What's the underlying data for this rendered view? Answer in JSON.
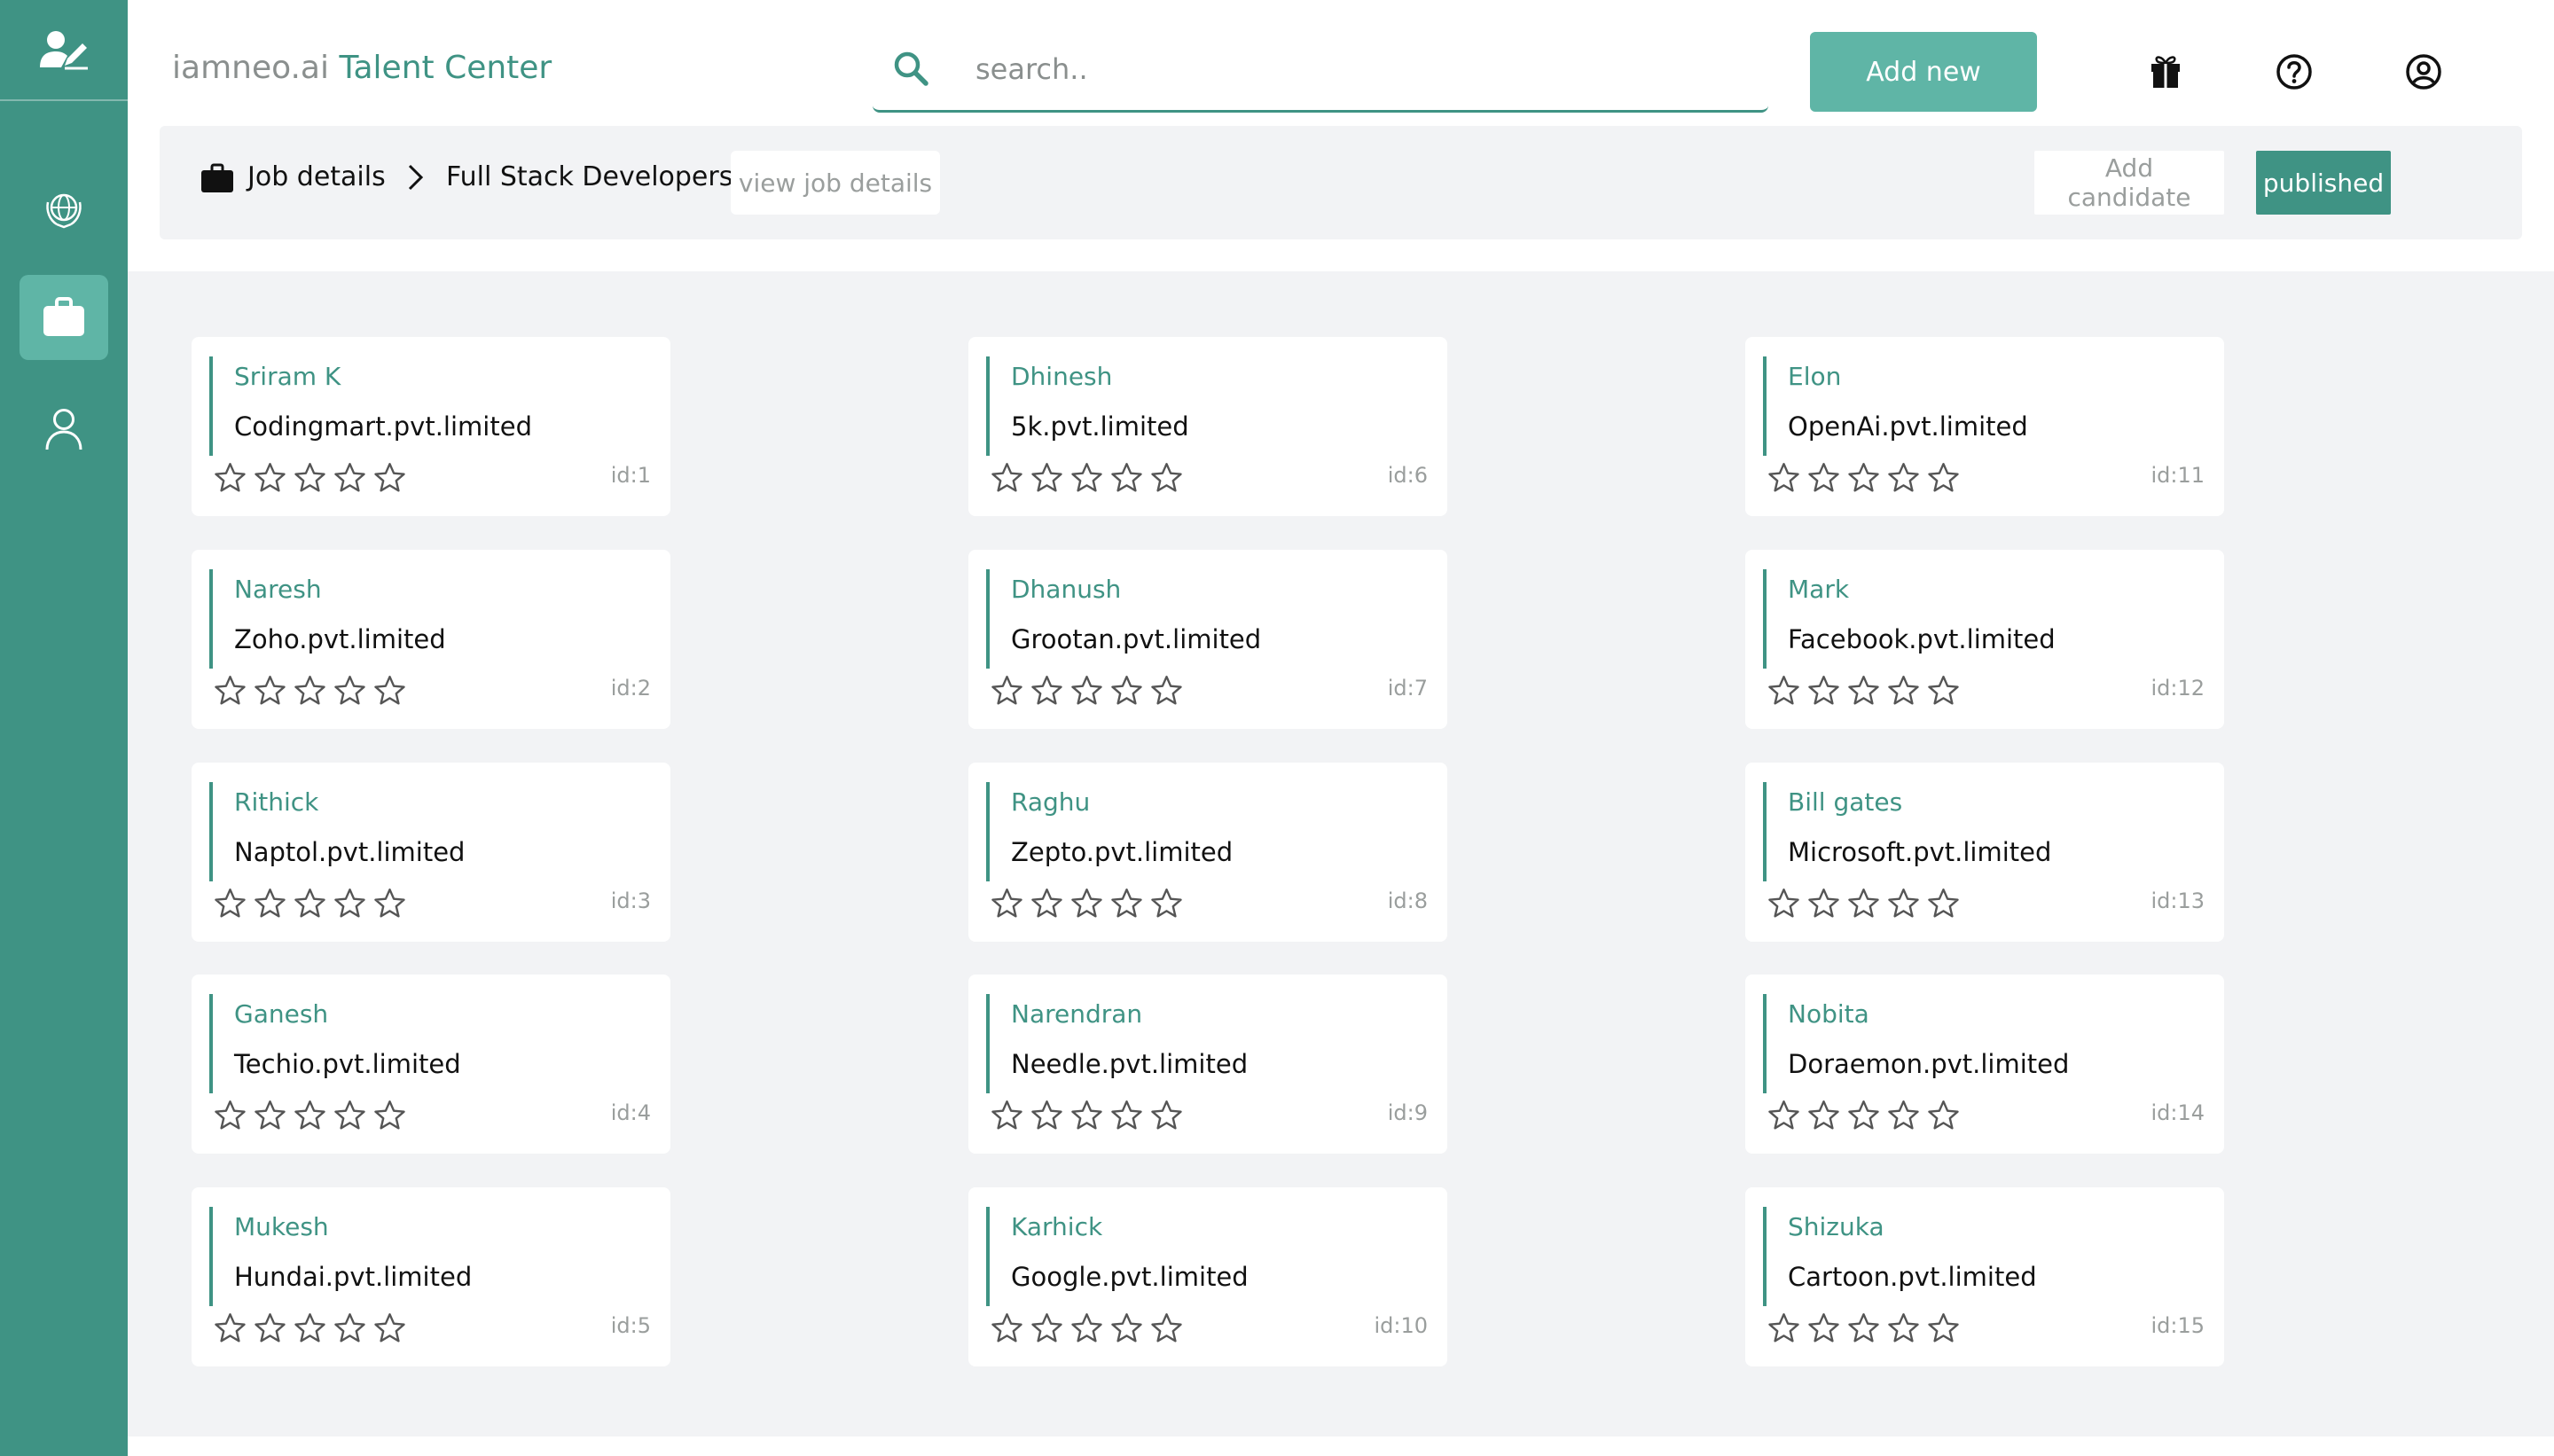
{
  "app": {
    "brand_prefix": "iamneo.ai",
    "brand_name": "Talent Center"
  },
  "sidebar": {
    "items": [
      {
        "name": "globe-icon",
        "active": false
      },
      {
        "name": "briefcase-icon",
        "active": true
      },
      {
        "name": "user-icon",
        "active": false
      }
    ]
  },
  "search": {
    "placeholder": "search..",
    "value": ""
  },
  "header": {
    "add_new_label": "Add new",
    "icons": [
      "gift-icon",
      "help-icon",
      "account-icon"
    ]
  },
  "job": {
    "section_label": "Job details",
    "title": "Full Stack Developers",
    "view_details_label": "view job details",
    "add_candidate_label": "Add candidate",
    "status_label": "published"
  },
  "colors": {
    "accent": "#3f9384",
    "accent_light": "#5fb5a6",
    "background": "#f2f3f5"
  },
  "candidates": [
    {
      "name": "Sriram K",
      "company": "Codingmart.pvt.limited",
      "id": "id:1",
      "rating": 0
    },
    {
      "name": "Naresh",
      "company": "Zoho.pvt.limited",
      "id": "id:2",
      "rating": 0
    },
    {
      "name": "Rithick",
      "company": "Naptol.pvt.limited",
      "id": "id:3",
      "rating": 0
    },
    {
      "name": "Ganesh",
      "company": "Techio.pvt.limited",
      "id": "id:4",
      "rating": 0
    },
    {
      "name": "Mukesh",
      "company": "Hundai.pvt.limited",
      "id": "id:5",
      "rating": 0
    },
    {
      "name": "Dhinesh",
      "company": "5k.pvt.limited",
      "id": "id:6",
      "rating": 0
    },
    {
      "name": "Dhanush",
      "company": "Grootan.pvt.limited",
      "id": "id:7",
      "rating": 0
    },
    {
      "name": "Raghu",
      "company": "Zepto.pvt.limited",
      "id": "id:8",
      "rating": 0
    },
    {
      "name": "Narendran",
      "company": "Needle.pvt.limited",
      "id": "id:9",
      "rating": 0
    },
    {
      "name": "Karhick",
      "company": "Google.pvt.limited",
      "id": "id:10",
      "rating": 0
    },
    {
      "name": "Elon",
      "company": "OpenAi.pvt.limited",
      "id": "id:11",
      "rating": 0
    },
    {
      "name": "Mark",
      "company": "Facebook.pvt.limited",
      "id": "id:12",
      "rating": 0
    },
    {
      "name": "Bill gates",
      "company": "Microsoft.pvt.limited",
      "id": "id:13",
      "rating": 0
    },
    {
      "name": "Nobita",
      "company": "Doraemon.pvt.limited",
      "id": "id:14",
      "rating": 0
    },
    {
      "name": "Shizuka",
      "company": "Cartoon.pvt.limited",
      "id": "id:15",
      "rating": 0
    }
  ]
}
